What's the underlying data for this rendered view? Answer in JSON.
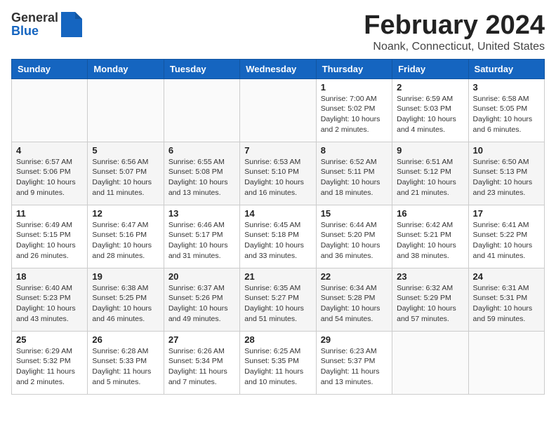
{
  "header": {
    "logo_general": "General",
    "logo_blue": "Blue",
    "month_title": "February 2024",
    "location": "Noank, Connecticut, United States"
  },
  "weekdays": [
    "Sunday",
    "Monday",
    "Tuesday",
    "Wednesday",
    "Thursday",
    "Friday",
    "Saturday"
  ],
  "weeks": [
    [
      {
        "day": "",
        "info": ""
      },
      {
        "day": "",
        "info": ""
      },
      {
        "day": "",
        "info": ""
      },
      {
        "day": "",
        "info": ""
      },
      {
        "day": "1",
        "info": "Sunrise: 7:00 AM\nSunset: 5:02 PM\nDaylight: 10 hours\nand 2 minutes."
      },
      {
        "day": "2",
        "info": "Sunrise: 6:59 AM\nSunset: 5:03 PM\nDaylight: 10 hours\nand 4 minutes."
      },
      {
        "day": "3",
        "info": "Sunrise: 6:58 AM\nSunset: 5:05 PM\nDaylight: 10 hours\nand 6 minutes."
      }
    ],
    [
      {
        "day": "4",
        "info": "Sunrise: 6:57 AM\nSunset: 5:06 PM\nDaylight: 10 hours\nand 9 minutes."
      },
      {
        "day": "5",
        "info": "Sunrise: 6:56 AM\nSunset: 5:07 PM\nDaylight: 10 hours\nand 11 minutes."
      },
      {
        "day": "6",
        "info": "Sunrise: 6:55 AM\nSunset: 5:08 PM\nDaylight: 10 hours\nand 13 minutes."
      },
      {
        "day": "7",
        "info": "Sunrise: 6:53 AM\nSunset: 5:10 PM\nDaylight: 10 hours\nand 16 minutes."
      },
      {
        "day": "8",
        "info": "Sunrise: 6:52 AM\nSunset: 5:11 PM\nDaylight: 10 hours\nand 18 minutes."
      },
      {
        "day": "9",
        "info": "Sunrise: 6:51 AM\nSunset: 5:12 PM\nDaylight: 10 hours\nand 21 minutes."
      },
      {
        "day": "10",
        "info": "Sunrise: 6:50 AM\nSunset: 5:13 PM\nDaylight: 10 hours\nand 23 minutes."
      }
    ],
    [
      {
        "day": "11",
        "info": "Sunrise: 6:49 AM\nSunset: 5:15 PM\nDaylight: 10 hours\nand 26 minutes."
      },
      {
        "day": "12",
        "info": "Sunrise: 6:47 AM\nSunset: 5:16 PM\nDaylight: 10 hours\nand 28 minutes."
      },
      {
        "day": "13",
        "info": "Sunrise: 6:46 AM\nSunset: 5:17 PM\nDaylight: 10 hours\nand 31 minutes."
      },
      {
        "day": "14",
        "info": "Sunrise: 6:45 AM\nSunset: 5:18 PM\nDaylight: 10 hours\nand 33 minutes."
      },
      {
        "day": "15",
        "info": "Sunrise: 6:44 AM\nSunset: 5:20 PM\nDaylight: 10 hours\nand 36 minutes."
      },
      {
        "day": "16",
        "info": "Sunrise: 6:42 AM\nSunset: 5:21 PM\nDaylight: 10 hours\nand 38 minutes."
      },
      {
        "day": "17",
        "info": "Sunrise: 6:41 AM\nSunset: 5:22 PM\nDaylight: 10 hours\nand 41 minutes."
      }
    ],
    [
      {
        "day": "18",
        "info": "Sunrise: 6:40 AM\nSunset: 5:23 PM\nDaylight: 10 hours\nand 43 minutes."
      },
      {
        "day": "19",
        "info": "Sunrise: 6:38 AM\nSunset: 5:25 PM\nDaylight: 10 hours\nand 46 minutes."
      },
      {
        "day": "20",
        "info": "Sunrise: 6:37 AM\nSunset: 5:26 PM\nDaylight: 10 hours\nand 49 minutes."
      },
      {
        "day": "21",
        "info": "Sunrise: 6:35 AM\nSunset: 5:27 PM\nDaylight: 10 hours\nand 51 minutes."
      },
      {
        "day": "22",
        "info": "Sunrise: 6:34 AM\nSunset: 5:28 PM\nDaylight: 10 hours\nand 54 minutes."
      },
      {
        "day": "23",
        "info": "Sunrise: 6:32 AM\nSunset: 5:29 PM\nDaylight: 10 hours\nand 57 minutes."
      },
      {
        "day": "24",
        "info": "Sunrise: 6:31 AM\nSunset: 5:31 PM\nDaylight: 10 hours\nand 59 minutes."
      }
    ],
    [
      {
        "day": "25",
        "info": "Sunrise: 6:29 AM\nSunset: 5:32 PM\nDaylight: 11 hours\nand 2 minutes."
      },
      {
        "day": "26",
        "info": "Sunrise: 6:28 AM\nSunset: 5:33 PM\nDaylight: 11 hours\nand 5 minutes."
      },
      {
        "day": "27",
        "info": "Sunrise: 6:26 AM\nSunset: 5:34 PM\nDaylight: 11 hours\nand 7 minutes."
      },
      {
        "day": "28",
        "info": "Sunrise: 6:25 AM\nSunset: 5:35 PM\nDaylight: 11 hours\nand 10 minutes."
      },
      {
        "day": "29",
        "info": "Sunrise: 6:23 AM\nSunset: 5:37 PM\nDaylight: 11 hours\nand 13 minutes."
      },
      {
        "day": "",
        "info": ""
      },
      {
        "day": "",
        "info": ""
      }
    ]
  ]
}
